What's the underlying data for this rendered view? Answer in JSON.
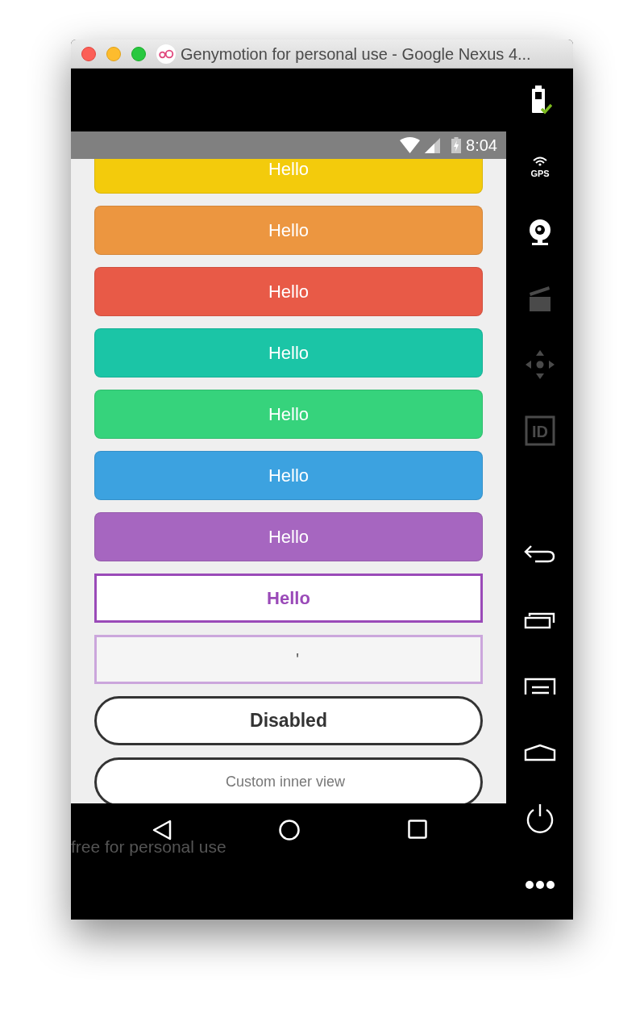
{
  "window": {
    "title": "Genymotion for personal use - Google Nexus 4..."
  },
  "status_bar": {
    "time": "8:04"
  },
  "buttons": [
    {
      "kind": "filled",
      "label": "Hello",
      "color": "#f3cb0c"
    },
    {
      "kind": "filled",
      "label": "Hello",
      "color": "#ec9640"
    },
    {
      "kind": "filled",
      "label": "Hello",
      "color": "#e85a47"
    },
    {
      "kind": "filled",
      "label": "Hello",
      "color": "#1bc5a6"
    },
    {
      "kind": "filled",
      "label": "Hello",
      "color": "#36d37c"
    },
    {
      "kind": "filled",
      "label": "Hello",
      "color": "#3ca2e0"
    },
    {
      "kind": "filled",
      "label": "Hello",
      "color": "#a666c0"
    },
    {
      "kind": "outline",
      "label": "Hello",
      "color": "#9a4ab8"
    },
    {
      "kind": "outline_faint",
      "label": "'",
      "color": "#cba6dc"
    },
    {
      "kind": "pill_bold",
      "label": "Disabled"
    },
    {
      "kind": "pill_light",
      "label": "Custom inner view"
    }
  ],
  "sidebar_top": [
    {
      "kind": "battery",
      "disabled": false
    },
    {
      "kind": "gps",
      "label": "GPS",
      "disabled": false
    },
    {
      "kind": "webcam",
      "disabled": false
    },
    {
      "kind": "clapper",
      "disabled": true
    },
    {
      "kind": "dpad",
      "disabled": true
    },
    {
      "kind": "id",
      "label": "ID",
      "disabled": true
    }
  ],
  "sidebar_bottom": [
    {
      "kind": "back",
      "disabled": false
    },
    {
      "kind": "recents",
      "disabled": false
    },
    {
      "kind": "menu",
      "disabled": false
    },
    {
      "kind": "home",
      "disabled": false
    },
    {
      "kind": "power",
      "disabled": false
    },
    {
      "kind": "more",
      "disabled": false
    }
  ],
  "watermark": "free for personal use"
}
